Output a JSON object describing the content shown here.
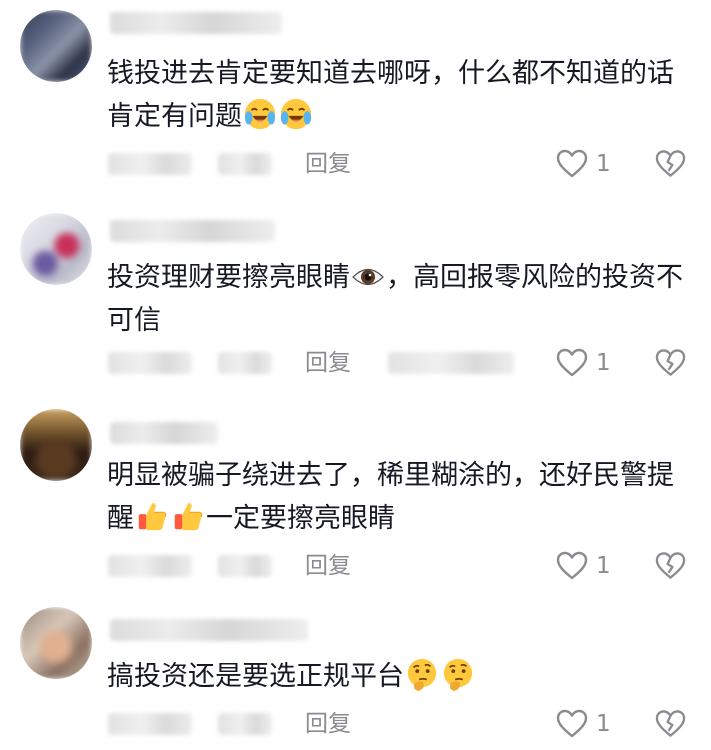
{
  "comments": [
    {
      "text": "钱投进去肯定要知道去哪呀，什么都不知道的话肯定有问题",
      "emojis": [
        "laughing-crying-emoji",
        "laughing-crying-emoji"
      ],
      "reply_label": "回复",
      "likes": "1"
    },
    {
      "text_before": "投资理财要擦亮眼睛",
      "text_after": "，高回报零风险的投资不可信",
      "emojis": [
        "eye-emoji"
      ],
      "reply_label": "回复",
      "likes": "1"
    },
    {
      "text_before": "明显被骗子绕进去了，稀里糊涂的，还好民警提醒",
      "text_after": "一定要擦亮眼睛",
      "emojis": [
        "thumbs-up-emoji",
        "thumbs-up-emoji"
      ],
      "reply_label": "回复",
      "likes": "1"
    },
    {
      "text": "搞投资还是要选正规平台",
      "emojis": [
        "thinking-emoji",
        "thinking-emoji"
      ],
      "reply_label": "回复",
      "likes": "1"
    }
  ],
  "colors": {
    "text": "#161823",
    "meta": "#8a8b91",
    "icon": "#8a8b91",
    "emoji_yellow": "#ffc83d"
  }
}
